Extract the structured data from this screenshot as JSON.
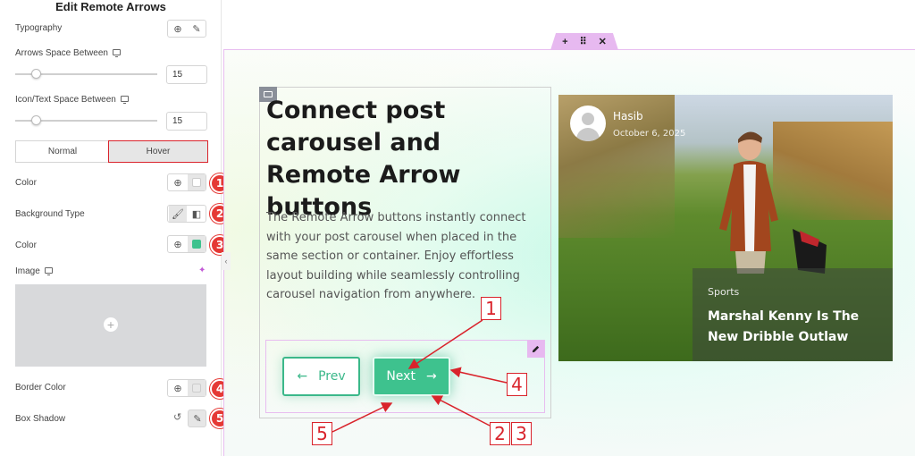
{
  "panel": {
    "title": "Edit Remote Arrows",
    "typography_label": "Typography",
    "arrows_space_label": "Arrows Space Between",
    "arrows_space_value": "15",
    "icon_text_space_label": "Icon/Text Space Between",
    "icon_text_space_value": "15",
    "tab_normal": "Normal",
    "tab_hover": "Hover",
    "color_label": "Color",
    "bg_type_label": "Background Type",
    "bg_color_label": "Color",
    "image_label": "Image",
    "border_color_label": "Border Color",
    "box_shadow_label": "Box Shadow",
    "colors": {
      "bg_color_swatch": "#3ec28e",
      "color_swatch": "#ffffff",
      "border_swatch": "#e8e8e8"
    },
    "badges": [
      "1",
      "2",
      "3",
      "4",
      "5"
    ]
  },
  "canvas": {
    "heading": "Connect post carousel and Remote Arrow buttons",
    "paragraph": "The Remote Arrow buttons instantly connect with your post carousel when placed in the same section or container. Enjoy effortless layout building while seamlessly controlling carousel navigation from anywhere.",
    "prev_label": "Prev",
    "next_label": "Next",
    "accent": "#3ec28e"
  },
  "card": {
    "author": "Hasib",
    "date": "October 6, 2025",
    "category": "Sports",
    "title": "Marshal Kenny Is The New Dribble Outlaw"
  },
  "annotations": [
    "1",
    "4",
    "5",
    "2",
    "3"
  ]
}
